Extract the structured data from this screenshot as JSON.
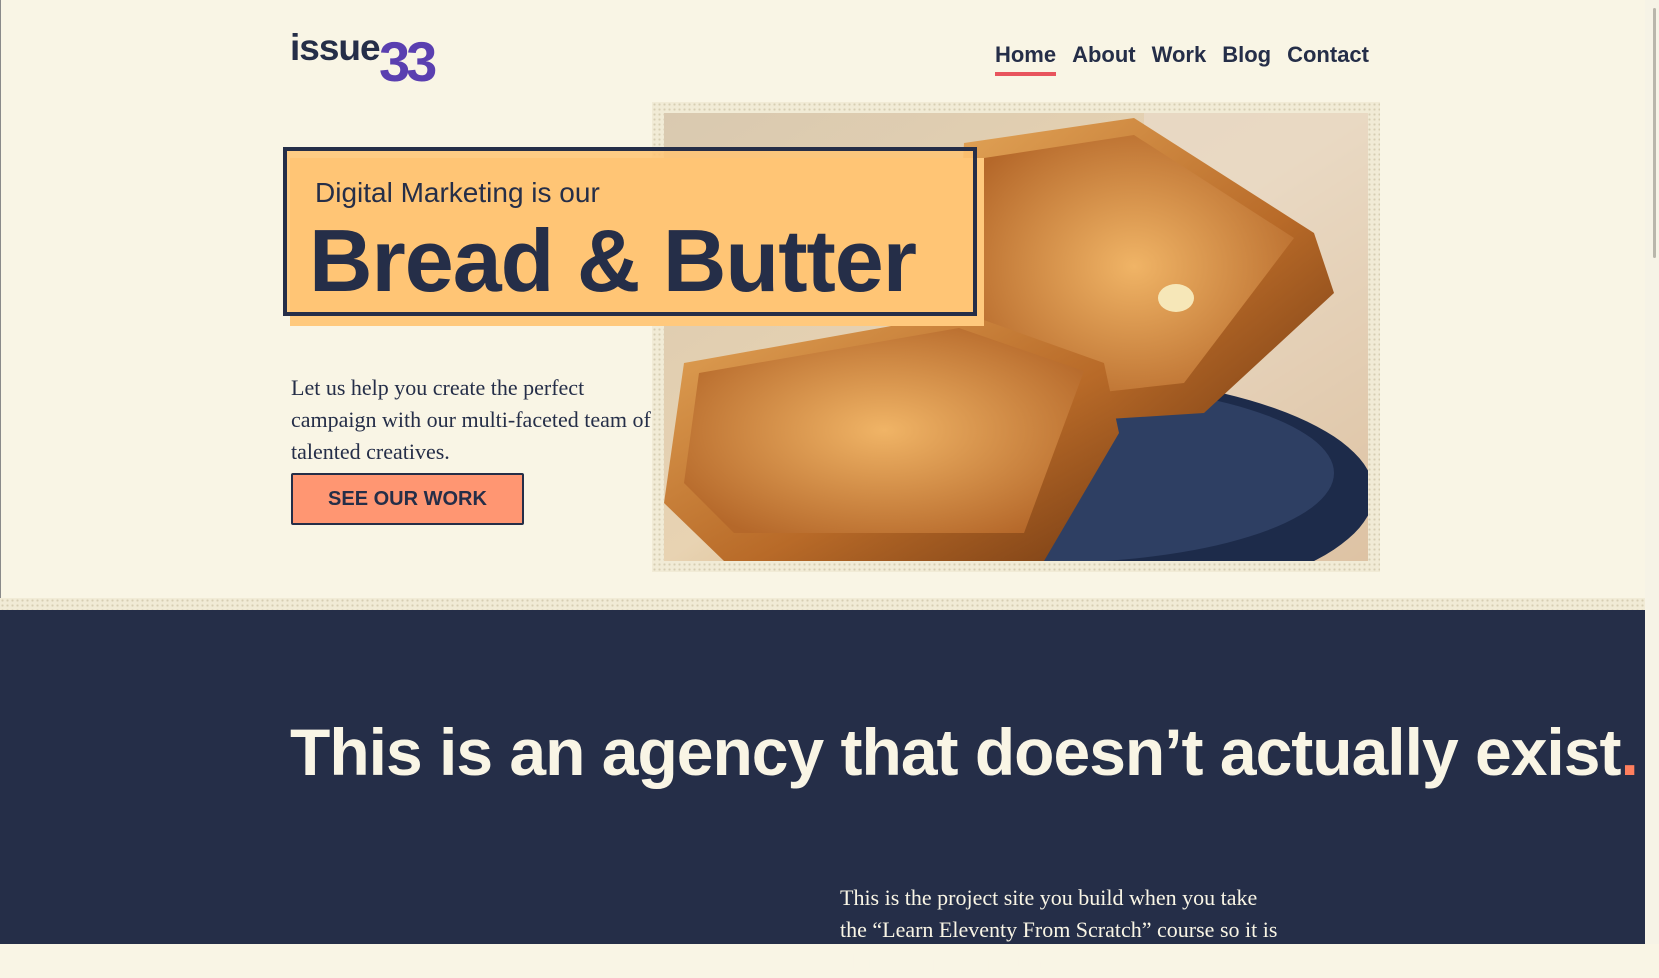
{
  "header": {
    "logo_word": "issue",
    "logo_number": "33",
    "nav": [
      {
        "label": "Home",
        "active": true
      },
      {
        "label": "About",
        "active": false
      },
      {
        "label": "Work",
        "active": false
      },
      {
        "label": "Blog",
        "active": false
      },
      {
        "label": "Contact",
        "active": false
      }
    ]
  },
  "hero": {
    "eyebrow": "Digital Marketing is our",
    "title": "Bread & Butter",
    "description": "Let us help you create the perfect campaign with our multi-faceted team of talented creatives.",
    "cta_label": "SEE OUR WORK",
    "image_icon": "toast-photo"
  },
  "intro": {
    "heading": "This is an agency that doesn’t actually exist",
    "heading_dot": ".",
    "body": "This is the project site you build when you take the “Learn Eleventy From Scratch” course so it is all made up as a pretend"
  },
  "colors": {
    "background": "#f9f5e5",
    "navy": "#252e48",
    "purple": "#5a3fb0",
    "accent_red": "#e8545d",
    "cta": "#ff9672",
    "highlight": "#ffc97d"
  }
}
